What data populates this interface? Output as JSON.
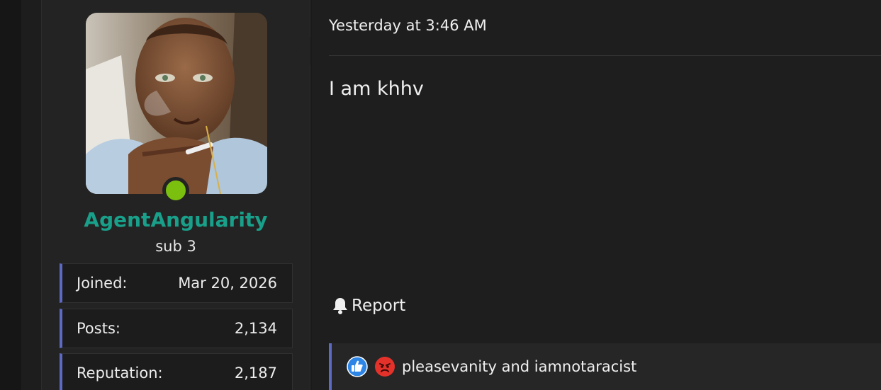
{
  "post": {
    "date": "Yesterday at 3:46 AM",
    "body": "I am khhv",
    "report_label": "Report"
  },
  "user": {
    "name": "AgentAngularity",
    "title": "sub 3",
    "online": true,
    "colors": {
      "name": "#19a08a",
      "online": "#7bbf0f",
      "stat_accent": "#5d6ac4"
    },
    "stats": [
      {
        "label": "Joined:",
        "value": "Mar 20, 2026"
      },
      {
        "label": "Posts:",
        "value": "2,134"
      },
      {
        "label": "Reputation:",
        "value": "2,187"
      }
    ]
  },
  "reactions": {
    "icons": [
      "like-icon",
      "angry-icon"
    ],
    "users_text": "pleasevanity and iamnotaracist"
  }
}
